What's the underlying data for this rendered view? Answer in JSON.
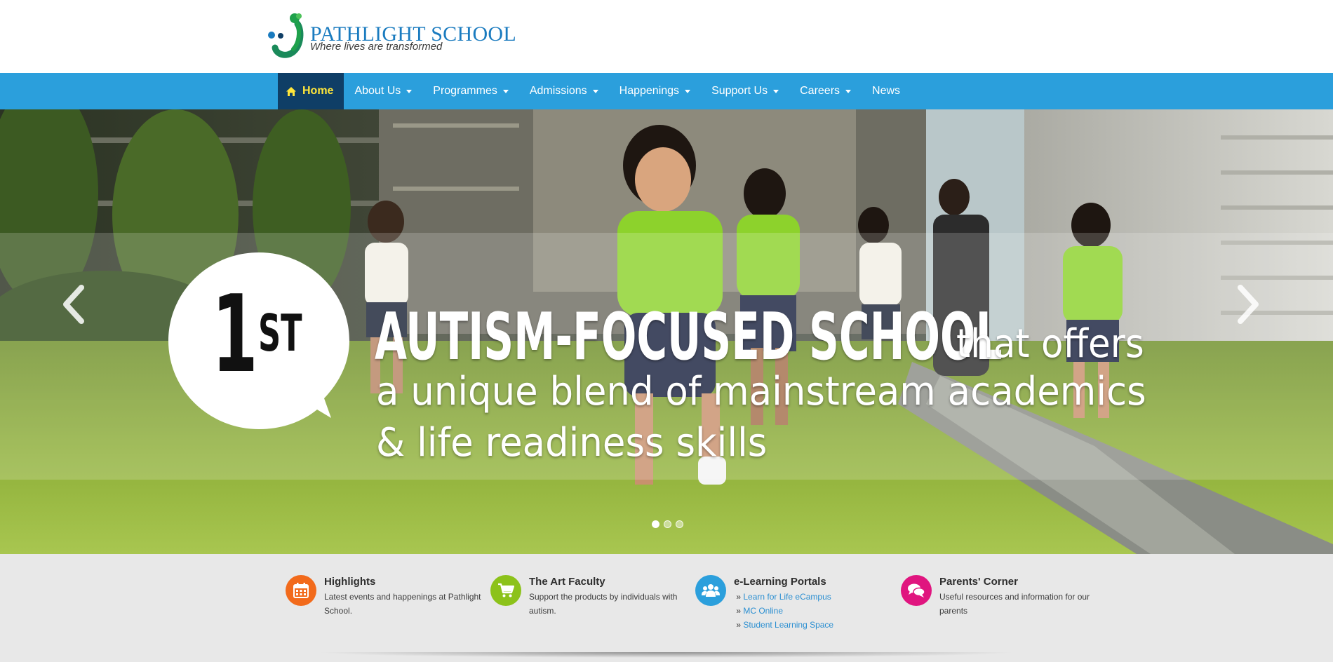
{
  "header": {
    "logo_title": "PATHLIGHT SCHOOL",
    "logo_tagline": "Where lives are transformed",
    "logo_colors": {
      "green": "#1fa14c",
      "blue": "#1a7bbf",
      "navy": "#0f3e66"
    }
  },
  "nav": {
    "background": "#2b9fdc",
    "active_background": "#0f3e66",
    "active_text_color": "#ffe63a",
    "items": [
      {
        "label": "Home",
        "icon": "home-icon",
        "active": true,
        "dropdown": false
      },
      {
        "label": "About Us",
        "dropdown": true
      },
      {
        "label": "Programmes",
        "dropdown": true
      },
      {
        "label": "Admissions",
        "dropdown": true
      },
      {
        "label": "Happenings",
        "dropdown": true
      },
      {
        "label": "Support Us",
        "dropdown": true
      },
      {
        "label": "Careers",
        "dropdown": true
      },
      {
        "label": "News",
        "dropdown": false
      }
    ]
  },
  "hero": {
    "badge_number": "1",
    "badge_suffix": "ST",
    "headline_bold": "AUTISM-FOCUSED SCHOOL",
    "headline_line1": "that offers",
    "headline_line2": "a unique blend of mainstream academics",
    "headline_line3": "& life readiness skills",
    "prev_icon": "chevron-left-icon",
    "next_icon": "chevron-right-icon",
    "slide_count": 3,
    "active_slide": 1
  },
  "features": [
    {
      "title": "Highlights",
      "icon": "calendar-icon",
      "color": "#f26a1b",
      "text": "Latest events and happenings at Pathlight School."
    },
    {
      "title": "The Art Faculty",
      "icon": "cart-icon",
      "color": "#8cc21a",
      "text": "Support the products by individuals with autism."
    },
    {
      "title": "e-Learning Portals",
      "icon": "users-icon",
      "color": "#2b9fdc",
      "links": [
        "Learn for Life eCampus",
        "MC Online",
        "Student Learning Space"
      ]
    },
    {
      "title": "Parents' Corner",
      "icon": "chat-icon",
      "color": "#e0157f",
      "text": "Useful resources and information for our parents"
    }
  ]
}
